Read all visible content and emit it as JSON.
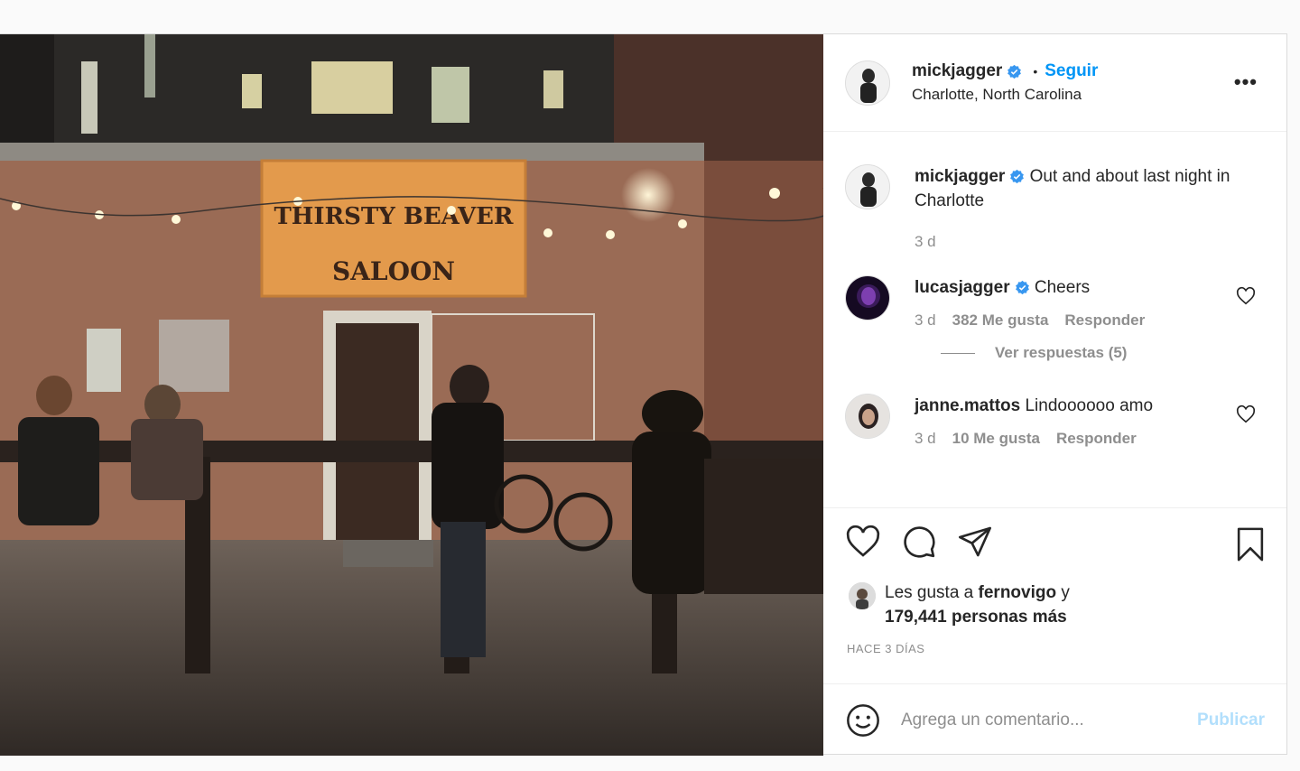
{
  "post": {
    "author": "mickjagger",
    "follow_label": "Seguir",
    "separator": "•",
    "location": "Charlotte, North Carolina",
    "more_label": "•••",
    "sign": {
      "line1": "THIRSTY BEAVER",
      "line2": "SALOON"
    },
    "caption": {
      "user": "mickjagger",
      "text": "Out and about last night in Charlotte",
      "time": "3 d"
    },
    "comments": [
      {
        "user": "lucasjagger",
        "verified": true,
        "text": "Cheers",
        "time": "3 d",
        "likes": "382 Me gusta",
        "reply": "Responder"
      },
      {
        "user": "janne.mattos",
        "verified": false,
        "text": "Lindoooooo amo",
        "time": "3 d",
        "likes": "10 Me gusta",
        "reply": "Responder"
      }
    ],
    "view_replies": "Ver respuestas (5)",
    "likes": {
      "prefix": "Les gusta a ",
      "user": "fernovigo",
      "suffix": " y",
      "others": "179,441 personas más"
    },
    "date_label": "HACE 3 DÍAS",
    "add_comment": {
      "placeholder": "Agrega un comentario...",
      "publish": "Publicar"
    },
    "colors": {
      "link": "#0095f6",
      "publish_disabled": "#b2dffc",
      "muted": "#8e8e8e",
      "text": "#262626"
    },
    "icons": [
      "heart-icon",
      "comment-icon",
      "share-icon",
      "bookmark-icon",
      "smile-icon",
      "verified-icon",
      "more-icon"
    ]
  }
}
